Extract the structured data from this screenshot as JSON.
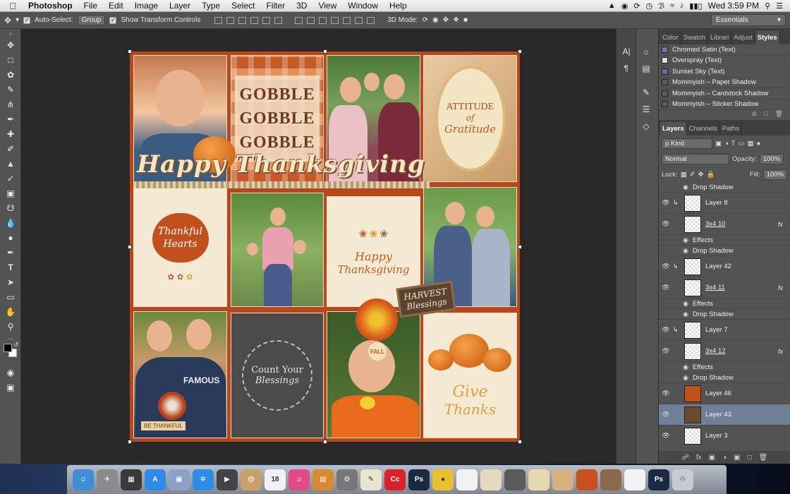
{
  "menubar": {
    "apple": "",
    "items": [
      "Photoshop",
      "File",
      "Edit",
      "Image",
      "Layer",
      "Type",
      "Select",
      "Filter",
      "3D",
      "View",
      "Window",
      "Help"
    ],
    "clock": "Wed 3:59 PM"
  },
  "options": {
    "auto_select_label": "Auto-Select:",
    "auto_select_value": "Group",
    "transform_label": "Show Transform Controls",
    "mode3d_label": "3D Mode:",
    "workspace": "Essentials"
  },
  "canvas": {
    "gobble": [
      "GOBBLE",
      "GOBBLE",
      "GOBBLE"
    ],
    "attitude": "ATTITUDE",
    "of": "of",
    "gratitude": "Gratitude",
    "thankful": "Thankful",
    "hearts": "Hearts",
    "happy_thanksgiving": "Happy Thanksgiving",
    "happy": "Happy",
    "thanksgiving": "Thanksgiving",
    "harvest": "HARVEST",
    "blessings": "Blessings",
    "count_your": "Count Your",
    "blessings2": "Blessings",
    "give": "Give",
    "thanks": "Thanks",
    "be_thankful": "BE THANKFUL",
    "famous": "FAMOUS",
    "fall": "FALL"
  },
  "styles_panel": {
    "tabs": [
      "Color",
      "Swatch",
      "Librari",
      "Adjust",
      "Styles"
    ],
    "items": [
      {
        "name": "Chromed Satin (Text)",
        "color": "#6a7fb0"
      },
      {
        "name": "Overspray (Text)",
        "color": "#dedede"
      },
      {
        "name": "Sunset Sky (Text)",
        "color": "#7a5fb0"
      },
      {
        "name": "Mommyish – Paper Shadow",
        "color": "#5a5a5a"
      },
      {
        "name": "Mommyish – Cardstock Shadow",
        "color": "#5a5a5a"
      },
      {
        "name": "Mommyish – Sticker Shadow",
        "color": "#5a5a5a"
      }
    ]
  },
  "layers_panel": {
    "tabs": [
      "Layers",
      "Channels",
      "Paths"
    ],
    "kind": "ρ Kind",
    "blend": "Normal",
    "opacity_label": "Opacity:",
    "opacity": "100%",
    "lock_label": "Lock:",
    "fill_label": "Fill:",
    "fill": "100%",
    "rows": [
      {
        "type": "sub",
        "name": "Drop Shadow"
      },
      {
        "type": "layer",
        "name": "Layer 8",
        "clip": true
      },
      {
        "type": "layer",
        "name": "3x4 10",
        "fx": "fx",
        "underline": true
      },
      {
        "type": "sub",
        "name": "Effects"
      },
      {
        "type": "sub",
        "name": "Drop Shadow"
      },
      {
        "type": "layer",
        "name": "Layer 42",
        "clip": true
      },
      {
        "type": "layer",
        "name": "3x4 11",
        "fx": "fx",
        "underline": true
      },
      {
        "type": "sub",
        "name": "Effects"
      },
      {
        "type": "sub",
        "name": "Drop Shadow"
      },
      {
        "type": "layer",
        "name": "Layer 7",
        "clip": true
      },
      {
        "type": "layer",
        "name": "3x4 12",
        "fx": "fx",
        "underline": true
      },
      {
        "type": "sub",
        "name": "Effects"
      },
      {
        "type": "sub",
        "name": "Drop Shadow"
      },
      {
        "type": "layer",
        "name": "Layer 46",
        "thumb": "#c2501f"
      },
      {
        "type": "layer",
        "name": "Layer 43",
        "thumb": "#6b4a30",
        "selected": true
      },
      {
        "type": "layer",
        "name": "Layer 3"
      }
    ]
  },
  "dock": {
    "items": [
      {
        "name": "finder",
        "color": "#3f8fd8",
        "glyph": "☺"
      },
      {
        "name": "launchpad",
        "color": "#8a8a8a",
        "glyph": "✈"
      },
      {
        "name": "dashboard",
        "color": "#3a3a3a",
        "glyph": "▦"
      },
      {
        "name": "app-store",
        "color": "#2f8be8",
        "glyph": "A"
      },
      {
        "name": "preview",
        "color": "#8aa2c8",
        "glyph": "▣"
      },
      {
        "name": "safari",
        "color": "#2d8ce6",
        "glyph": "✲"
      },
      {
        "name": "facetime",
        "color": "#444",
        "glyph": "▶"
      },
      {
        "name": "contacts",
        "color": "#c8a068",
        "glyph": "@"
      },
      {
        "name": "calendar",
        "color": "#f2f2f2",
        "glyph": "18"
      },
      {
        "name": "itunes",
        "color": "#e24a8a",
        "glyph": "♫"
      },
      {
        "name": "photos",
        "color": "#d88a30",
        "glyph": "▤"
      },
      {
        "name": "system-prefs",
        "color": "#777",
        "glyph": "⚙"
      },
      {
        "name": "textedit",
        "color": "#e9e4d0",
        "glyph": "✎"
      },
      {
        "name": "creative-cloud",
        "color": "#d8232a",
        "glyph": "Cc"
      },
      {
        "name": "photoshop",
        "color": "#1a2a44",
        "glyph": "Ps"
      },
      {
        "name": "chrome",
        "color": "#e8c030",
        "glyph": "●"
      },
      {
        "name": "file1",
        "color": "#f2f2f2",
        "glyph": ""
      },
      {
        "name": "file2",
        "color": "#e6d8c0",
        "glyph": ""
      },
      {
        "name": "file3",
        "color": "#5a5a5a",
        "glyph": ""
      },
      {
        "name": "file4",
        "color": "#e8d8b0",
        "glyph": ""
      },
      {
        "name": "file5",
        "color": "#d8b080",
        "glyph": ""
      },
      {
        "name": "file6",
        "color": "#c85020",
        "glyph": ""
      },
      {
        "name": "file7",
        "color": "#8a6a4a",
        "glyph": ""
      },
      {
        "name": "file8",
        "color": "#f2f2f2",
        "glyph": ""
      },
      {
        "name": "ps-file",
        "color": "#1a2a44",
        "glyph": "Ps"
      },
      {
        "name": "trash",
        "color": "#c8ccd2",
        "glyph": "♲"
      }
    ]
  }
}
